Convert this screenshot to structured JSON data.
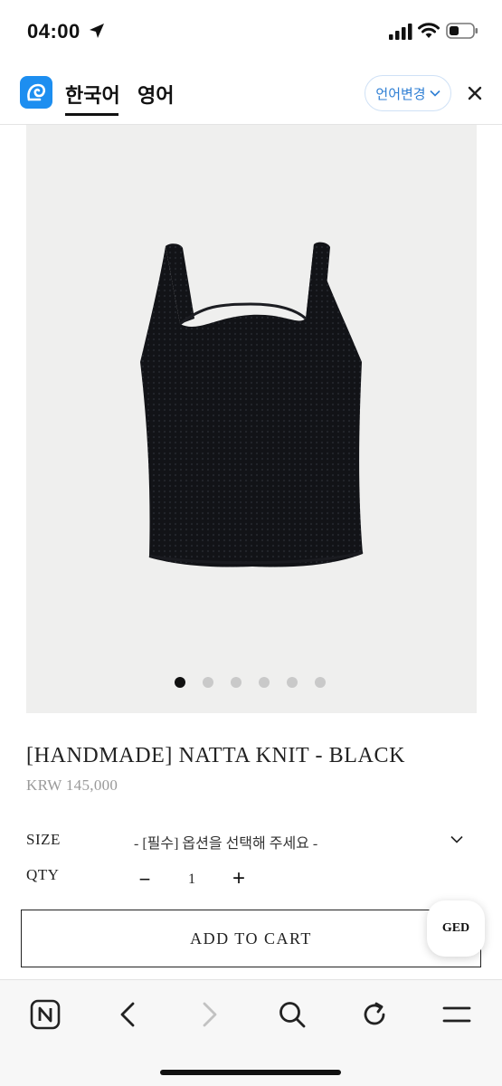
{
  "status_bar": {
    "time": "04:00",
    "icons": [
      "location-arrow-icon",
      "cellular-signal-icon",
      "wifi-icon",
      "battery-icon"
    ]
  },
  "translate_bar": {
    "logo": "papago-logo-icon",
    "tabs": [
      {
        "label": "한국어",
        "active": true
      },
      {
        "label": "영어",
        "active": false
      }
    ],
    "change_language_label": "언어변경",
    "close_icon": "close-icon"
  },
  "product": {
    "gallery": {
      "total_images": 6,
      "active_index": 0
    },
    "title": "[HANDMADE] NATTA KNIT - BLACK",
    "price": "KRW 145,000",
    "options": {
      "size_label": "SIZE",
      "size_placeholder": "- [필수] 옵션을 선택해 주세요 -",
      "qty_label": "QTY",
      "qty_minus": "−",
      "qty_value": "1",
      "qty_plus": "+"
    },
    "add_to_cart_label": "ADD TO CART",
    "badge_label": "GED"
  },
  "toolbar": {
    "icons": [
      "naver-home-icon",
      "back-arrow-icon",
      "forward-arrow-icon",
      "search-icon",
      "refresh-icon",
      "menu-icon"
    ]
  },
  "colors": {
    "accent_blue": "#1d8ef0",
    "image_background": "#efefee",
    "garment": "#121317",
    "price_gray": "#9a9a9a"
  }
}
